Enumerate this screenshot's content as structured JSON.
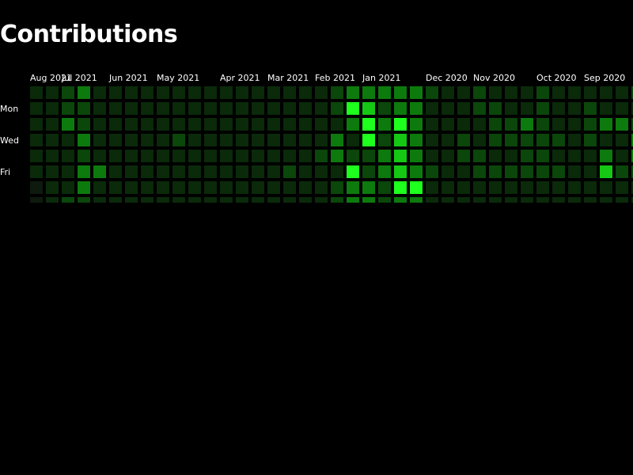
{
  "title": "Contributions",
  "colors": {
    "background": "#000000",
    "text": "#ffffff",
    "levels": [
      "#0e1a0e",
      "#0a2a0a",
      "#0b460b",
      "#0d7a0d",
      "#14c814",
      "#1eff1e"
    ]
  },
  "chart_data": {
    "type": "heatmap",
    "day_labels": [
      "Mon",
      "Wed",
      "Fri"
    ],
    "month_labels": [
      "Aug 2021",
      "Jul 2021",
      "Jun 2021",
      "May 2021",
      "Apr 2021",
      "Mar 2021",
      "Feb 2021",
      "Jan 2021",
      "Dec 2020",
      "Nov 2020",
      "Oct 2020",
      "Sep 2020"
    ],
    "month_label_week": [
      0,
      2,
      5,
      8,
      12,
      15,
      18,
      21,
      25,
      28,
      32,
      35
    ],
    "levels": [
      [
        1,
        1,
        1,
        1,
        1,
        1,
        0,
        0,
        0,
        1,
        0
      ],
      [
        1,
        1,
        1,
        1,
        1,
        1,
        1,
        1,
        1,
        1,
        1
      ],
      [
        2,
        2,
        3,
        1,
        1,
        1,
        1,
        2,
        2,
        2,
        2
      ],
      [
        3,
        2,
        2,
        3,
        2,
        3,
        3,
        2,
        3,
        3,
        3
      ],
      [
        1,
        1,
        1,
        1,
        1,
        3,
        1,
        1,
        1,
        1,
        1
      ],
      [
        1,
        1,
        1,
        1,
        1,
        1,
        1,
        1,
        1,
        1,
        1
      ],
      [
        1,
        1,
        1,
        1,
        1,
        1,
        1,
        1,
        1,
        1,
        1
      ],
      [
        1,
        1,
        1,
        1,
        1,
        1,
        1,
        1,
        1,
        1,
        1
      ],
      [
        1,
        1,
        1,
        1,
        1,
        1,
        1,
        1,
        1,
        1,
        1
      ],
      [
        1,
        1,
        1,
        2,
        1,
        1,
        1,
        1,
        1,
        1,
        1
      ],
      [
        1,
        1,
        1,
        1,
        1,
        1,
        1,
        1,
        1,
        1,
        1
      ],
      [
        1,
        1,
        1,
        1,
        1,
        1,
        1,
        1,
        1,
        1,
        1
      ],
      [
        1,
        1,
        1,
        1,
        1,
        1,
        1,
        1,
        1,
        1,
        1
      ],
      [
        1,
        1,
        1,
        1,
        1,
        1,
        1,
        1,
        1,
        1,
        1
      ],
      [
        1,
        1,
        1,
        1,
        1,
        1,
        1,
        1,
        1,
        1,
        1
      ],
      [
        1,
        1,
        1,
        1,
        1,
        1,
        1,
        1,
        1,
        1,
        1
      ],
      [
        1,
        1,
        1,
        1,
        1,
        2,
        1,
        1,
        1,
        1,
        1
      ],
      [
        1,
        1,
        1,
        1,
        1,
        1,
        1,
        1,
        1,
        1,
        1
      ],
      [
        1,
        1,
        1,
        1,
        2,
        1,
        1,
        1,
        1,
        1,
        1
      ],
      [
        2,
        2,
        1,
        3,
        3,
        1,
        2,
        2,
        2,
        2,
        2
      ],
      [
        3,
        5,
        3,
        1,
        2,
        5,
        3,
        3,
        3,
        3,
        4
      ],
      [
        3,
        4,
        5,
        5,
        2,
        2,
        3,
        3,
        3,
        3,
        2
      ],
      [
        3,
        2,
        3,
        2,
        3,
        3,
        2,
        2,
        3,
        3,
        3
      ],
      [
        3,
        3,
        5,
        4,
        4,
        4,
        5,
        3,
        3,
        3,
        3
      ],
      [
        3,
        3,
        3,
        3,
        3,
        3,
        5,
        3,
        3,
        3,
        3
      ],
      [
        2,
        1,
        1,
        1,
        1,
        2,
        1,
        1,
        1,
        1,
        1
      ],
      [
        1,
        1,
        1,
        1,
        1,
        1,
        1,
        1,
        1,
        1,
        2
      ],
      [
        1,
        1,
        1,
        2,
        2,
        1,
        1,
        1,
        1,
        1,
        1
      ],
      [
        2,
        2,
        1,
        1,
        2,
        2,
        1,
        1,
        1,
        1,
        1
      ],
      [
        1,
        2,
        2,
        2,
        1,
        2,
        1,
        1,
        1,
        1,
        1
      ],
      [
        1,
        1,
        2,
        2,
        1,
        2,
        1,
        1,
        1,
        1,
        1
      ],
      [
        1,
        1,
        3,
        2,
        2,
        2,
        1,
        1,
        1,
        1,
        1
      ],
      [
        2,
        2,
        2,
        2,
        2,
        2,
        1,
        1,
        1,
        1,
        1
      ],
      [
        1,
        1,
        1,
        2,
        1,
        2,
        1,
        1,
        1,
        1,
        1
      ],
      [
        1,
        1,
        1,
        1,
        1,
        1,
        1,
        1,
        1,
        1,
        1
      ],
      [
        1,
        2,
        2,
        2,
        1,
        1,
        1,
        1,
        1,
        1,
        1
      ],
      [
        1,
        1,
        3,
        1,
        3,
        4,
        1,
        1,
        1,
        1,
        1
      ],
      [
        1,
        1,
        3,
        1,
        1,
        2,
        1,
        1,
        1,
        1,
        1
      ],
      [
        2,
        1,
        2,
        3,
        3,
        2,
        1,
        1,
        1,
        1,
        1
      ],
      [
        1,
        2,
        2,
        3,
        1,
        1,
        1,
        1,
        1,
        1,
        1
      ]
    ]
  }
}
